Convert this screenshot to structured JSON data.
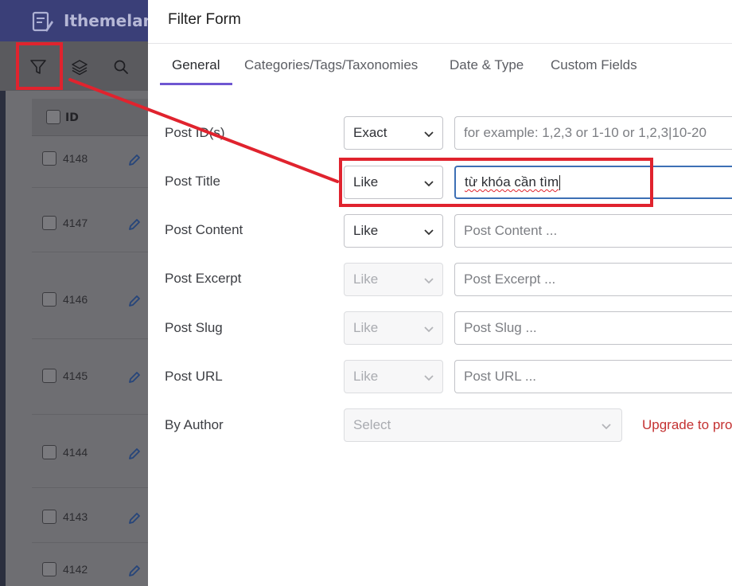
{
  "app": {
    "brand": "Ithemeland",
    "table": {
      "id_header": "ID",
      "rows": [
        "4148",
        "4147",
        "4146",
        "4145",
        "4144",
        "4143",
        "4142"
      ]
    }
  },
  "modal": {
    "title": "Filter Form",
    "tabs": [
      "General",
      "Categories/Tags/Taxonomies",
      "Date & Type",
      "Custom Fields"
    ],
    "active_tab": "General",
    "fields": [
      {
        "label": "Post ID(s)",
        "operator": "Exact",
        "value": "",
        "placeholder": "for example: 1,2,3 or 1-10 or 1,2,3|10-20",
        "disabled": false
      },
      {
        "label": "Post Title",
        "operator": "Like",
        "value": "từ khóa cần tìm",
        "placeholder": "",
        "disabled": false
      },
      {
        "label": "Post Content",
        "operator": "Like",
        "value": "",
        "placeholder": "Post Content ...",
        "disabled": false
      },
      {
        "label": "Post Excerpt",
        "operator": "Like",
        "value": "",
        "placeholder": "Post Excerpt ...",
        "disabled": true
      },
      {
        "label": "Post Slug",
        "operator": "Like",
        "value": "",
        "placeholder": "Post Slug ...",
        "disabled": true
      },
      {
        "label": "Post URL",
        "operator": "Like",
        "value": "",
        "placeholder": "Post URL ...",
        "disabled": true
      }
    ],
    "author": {
      "label": "By Author",
      "placeholder": "Select",
      "upgrade_text": "Upgrade to pro"
    }
  },
  "colors": {
    "highlight": "#e0232e",
    "tab_accent": "#6f57d2",
    "focus_border": "#3d6fb5",
    "upgrade_text": "#c43232"
  },
  "icons": [
    "filter-icon",
    "layers-icon",
    "search-icon",
    "pencil-icon",
    "chevron-down-icon",
    "logo-icon"
  ]
}
